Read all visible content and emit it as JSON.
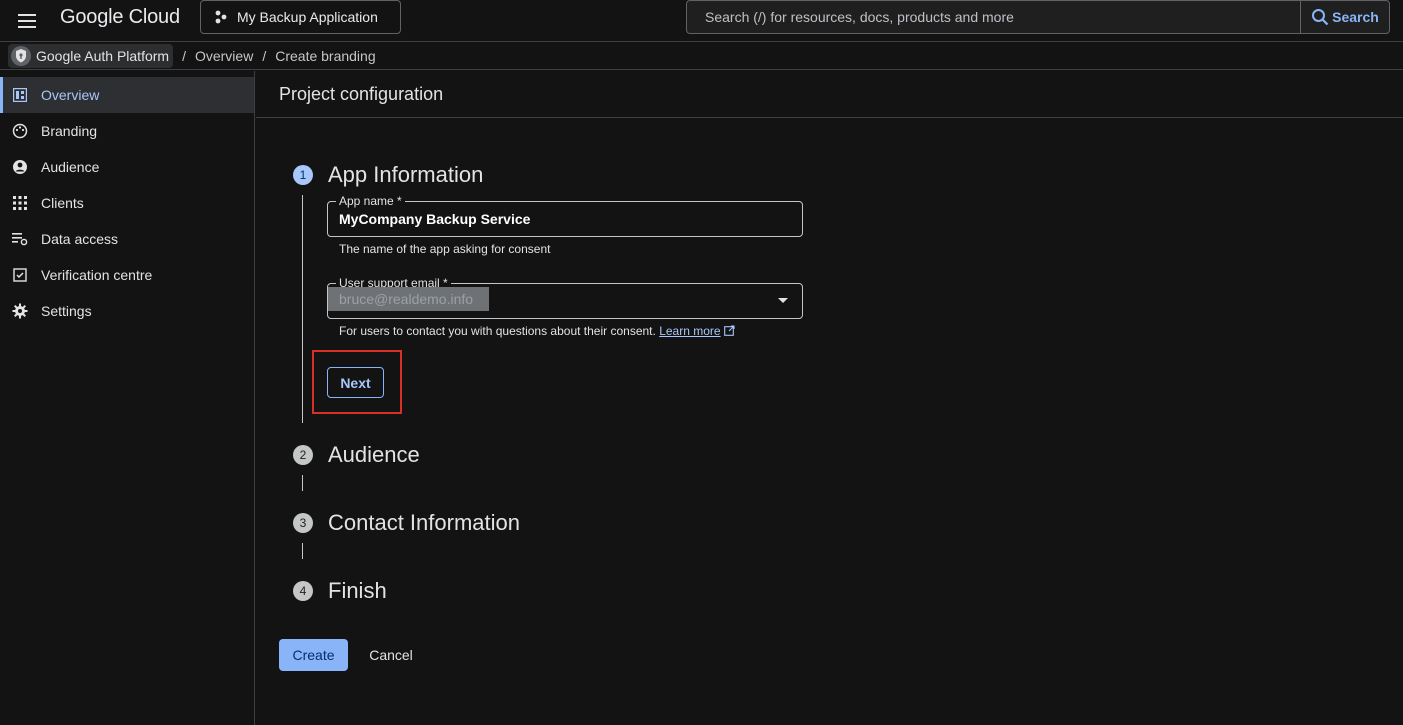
{
  "header": {
    "logo_text": "Google Cloud",
    "project_name": "My Backup Application",
    "search_placeholder": "Search (/) for resources, docs, products and more",
    "search_button": "Search"
  },
  "breadcrumb": {
    "items": [
      "Google Auth Platform",
      "Overview",
      "Create branding"
    ],
    "separator": "/"
  },
  "sidebar": {
    "items": [
      {
        "label": "Overview",
        "icon": "dashboard-icon",
        "active": true
      },
      {
        "label": "Branding",
        "icon": "palette-icon",
        "active": false
      },
      {
        "label": "Audience",
        "icon": "account-circle-icon",
        "active": false
      },
      {
        "label": "Clients",
        "icon": "apps-grid-icon",
        "active": false
      },
      {
        "label": "Data access",
        "icon": "data-access-icon",
        "active": false
      },
      {
        "label": "Verification centre",
        "icon": "verified-icon",
        "active": false
      },
      {
        "label": "Settings",
        "icon": "gear-icon",
        "active": false
      }
    ]
  },
  "main": {
    "title": "Project configuration",
    "steps": [
      {
        "number": "1",
        "title": "App Information",
        "active": true
      },
      {
        "number": "2",
        "title": "Audience",
        "active": false
      },
      {
        "number": "3",
        "title": "Contact Information",
        "active": false
      },
      {
        "number": "4",
        "title": "Finish",
        "active": false
      }
    ],
    "app_name": {
      "label": "App name *",
      "value": "MyCompany Backup Service",
      "hint": "The name of the app asking for consent"
    },
    "support_email": {
      "label": "User support email *",
      "value": "bruce@realdemo.info",
      "hint": "For users to contact you with questions about their consent.",
      "learn_more": "Learn more"
    },
    "next_label": "Next",
    "create_label": "Create",
    "cancel_label": "Cancel"
  },
  "colors": {
    "accent": "#8ab4f8",
    "highlight": "#d93025",
    "background": "#131314"
  }
}
